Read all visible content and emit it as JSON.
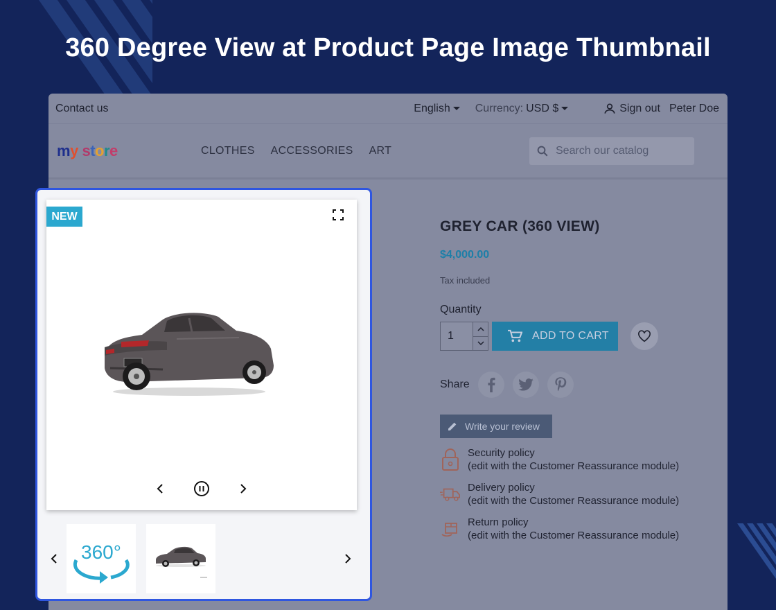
{
  "headline": "360 Degree View at Product Page Image Thumbnail",
  "topbar": {
    "contact": "Contact us",
    "language": "English",
    "currency_label": "Currency:",
    "currency_value": "USD $",
    "sign_out": "Sign out",
    "user_name": "Peter Doe"
  },
  "navbar": {
    "logo": "my store",
    "menu": [
      "CLOTHES",
      "ACCESSORIES",
      "ART"
    ],
    "search_placeholder": "Search our catalog"
  },
  "gallery": {
    "badge": "NEW",
    "thumb_360_label": "360°"
  },
  "product": {
    "title": "GREY CAR (360 VIEW)",
    "price": "$4,000.00",
    "tax": "Tax included",
    "quantity_label": "Quantity",
    "quantity_value": "1",
    "add_to_cart": "ADD TO CART",
    "share_label": "Share",
    "write_review": "Write your review"
  },
  "reassurance": [
    {
      "title": "Security policy",
      "desc": "(edit with the Customer Reassurance module)",
      "icon": "lock-icon"
    },
    {
      "title": "Delivery policy",
      "desc": "(edit with the Customer Reassurance module)",
      "icon": "truck-icon"
    },
    {
      "title": "Return policy",
      "desc": "(edit with the Customer Reassurance module)",
      "icon": "return-box-icon"
    }
  ],
  "colors": {
    "background": "#13245a",
    "highlight_border": "#2f56e0",
    "badge": "#2ba8cf",
    "price": "#1c7fa8"
  }
}
